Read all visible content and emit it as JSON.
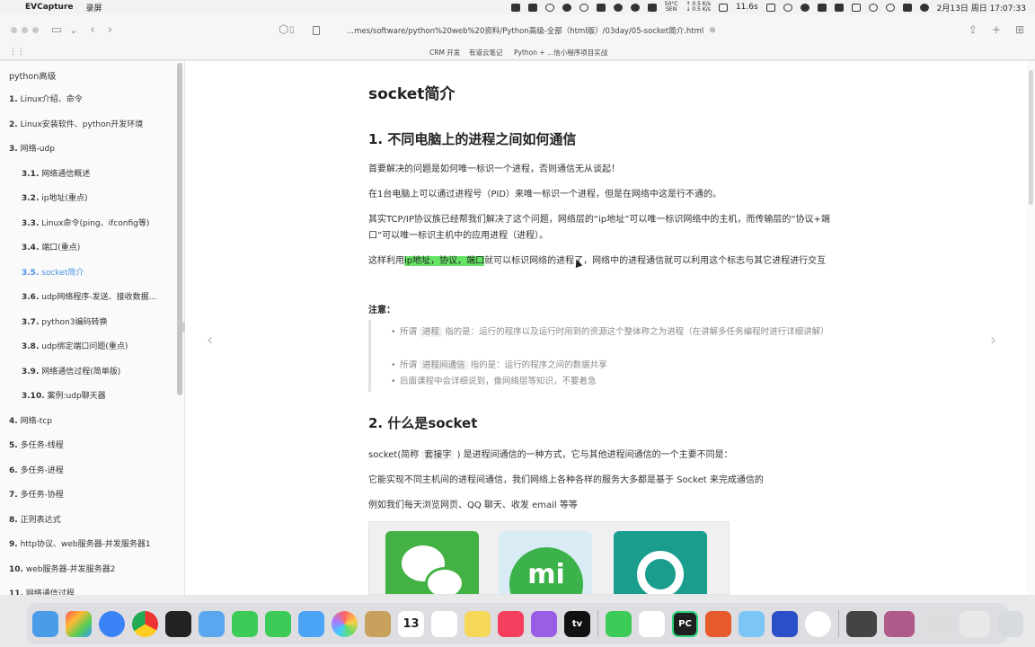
{
  "menubar": {
    "app_name": "EVCapture",
    "menu_record": "录屏",
    "cpu_temp": "50°C",
    "cpu_name": "SEN",
    "net_up": "↑ 0.5 K/s",
    "net_down": "↓ 0.5 K/s",
    "battery_time": "11.6s",
    "datetime": "2月13日 周日 17:07:33"
  },
  "browser": {
    "url": "...mes/software/python%20web%20资料/Python高级-全部（html版）/03day/05-socket简介.html",
    "bookmarks": [
      "CRM 开发",
      "有道云笔记",
      "Python + ...信小程序项目实战"
    ]
  },
  "sidebar": {
    "title": "python高级",
    "items": [
      {
        "num": "1.",
        "label": "Linux介绍、命令",
        "level": 1
      },
      {
        "num": "2.",
        "label": "Linux安装软件、python开发环境",
        "level": 1
      },
      {
        "num": "3.",
        "label": "网络-udp",
        "level": 1
      },
      {
        "num": "3.1.",
        "label": "网络通信概述",
        "level": 2
      },
      {
        "num": "3.2.",
        "label": "ip地址(重点)",
        "level": 2
      },
      {
        "num": "3.3.",
        "label": "Linux命令(ping、ifconfig等)",
        "level": 2
      },
      {
        "num": "3.4.",
        "label": "端口(重点)",
        "level": 2
      },
      {
        "num": "3.5.",
        "label": "socket简介",
        "level": 2,
        "active": true
      },
      {
        "num": "3.6.",
        "label": "udp网络程序-发送、接收数据...",
        "level": 2
      },
      {
        "num": "3.7.",
        "label": "python3编码转换",
        "level": 2
      },
      {
        "num": "3.8.",
        "label": "udp绑定端口问题(重点)",
        "level": 2
      },
      {
        "num": "3.9.",
        "label": "网络通信过程(简单版)",
        "level": 2
      },
      {
        "num": "3.10.",
        "label": "案例:udp聊天器",
        "level": 2
      },
      {
        "num": "4.",
        "label": "网络-tcp",
        "level": 1
      },
      {
        "num": "5.",
        "label": "多任务-线程",
        "level": 1
      },
      {
        "num": "6.",
        "label": "多任务-进程",
        "level": 1
      },
      {
        "num": "7.",
        "label": "多任务-协程",
        "level": 1
      },
      {
        "num": "8.",
        "label": "正则表达式",
        "level": 1
      },
      {
        "num": "9.",
        "label": "http协议、web服务器-并发服务器1",
        "level": 1
      },
      {
        "num": "10.",
        "label": "web服务器-并发服务器2",
        "level": 1
      },
      {
        "num": "11.",
        "label": "网络通信过程",
        "level": 1
      }
    ]
  },
  "content": {
    "title": "socket简介",
    "section1_title": "1. 不同电脑上的进程之间如何通信",
    "p1": "首要解决的问题是如何唯一标识一个进程，否则通信无从谈起！",
    "p2": "在1台电脑上可以通过进程号（PID）来唯一标识一个进程，但是在网络中这是行不通的。",
    "p3": "其实TCP/IP协议族已经帮我们解决了这个问题，网络层的“ip地址”可以唯一标识网络中的主机，而传输层的“协议+端口”可以唯一标识主机中的应用进程（进程）。",
    "p4_before": "这样利用",
    "p4_highlight": "ip地址，协议，端口",
    "p4_after": "就可以标识网络的进程了，网络中的进程通信就可以利用这个标志与其它进程进行交互",
    "note_title": "注意：",
    "notes": [
      {
        "pre": "所谓 ",
        "code": "进程",
        "post": " 指的是：运行的程序以及运行时用到的资源这个整体称之为进程（在讲解多任务编程时进行详细讲解）"
      },
      {
        "pre": "所谓 ",
        "code": "进程间通信",
        "post": " 指的是：运行的程序之间的数据共享"
      },
      {
        "pre": "",
        "code": "",
        "post": "后面课程中会详细说到，像网络层等知识，不要着急"
      }
    ],
    "section2_title": "2. 什么是socket",
    "s2_p1_before": "socket(简称 ",
    "s2_p1_code": "套接字",
    "s2_p1_after": " ) 是进程间通信的一种方式，它与其他进程间通信的一个主要不同是：",
    "s2_p2": "它能实现不同主机间的进程间通信，我们网络上各种各样的服务大多都是基于 Socket 来完成通信的",
    "s2_p3": "例如我们每天浏览网页、QQ 聊天、收发 email 等等",
    "mi_logo_text": "mi"
  },
  "dock": {
    "calendar_day": "13",
    "pycharm_label": "PC",
    "tv_label": "tv"
  }
}
